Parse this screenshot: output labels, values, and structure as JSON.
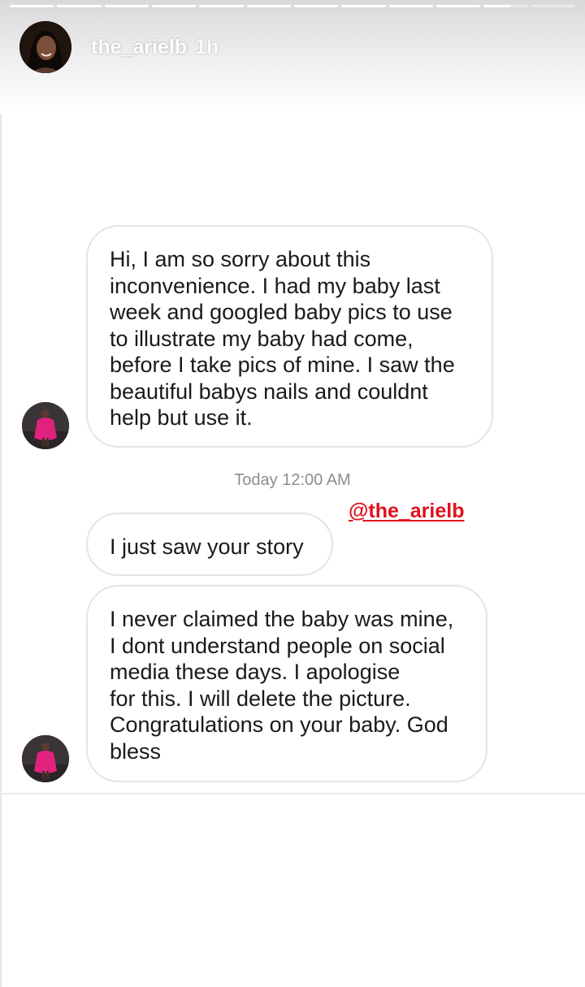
{
  "story_header": {
    "username": "the_arielb",
    "time_ago": "1h",
    "progress": {
      "segments_total": 12,
      "segments_viewed": 11,
      "current_segment_fraction": 0.6
    }
  },
  "messages": [
    {
      "id": "msg1",
      "text": "Hi, I am so sorry about this\ninconvenience. I had my baby last\nweek and googled baby pics to use\nto illustrate my baby had come,\nbefore I take pics of mine. I saw the\nbeautiful babys nails and couldnt\nhelp but use it."
    },
    {
      "id": "msg2",
      "text": "I just saw your story"
    },
    {
      "id": "msg3",
      "text": "I never claimed the baby was mine,\nI dont understand people on social\nmedia these days. I apologise\nfor this. I will delete the picture.\nCongratulations on your baby. God\nbless"
    }
  ],
  "timestamp": "Today 12:00 AM",
  "mention": "@the_arielb",
  "colors": {
    "mention": "#e0121e",
    "timestamp": "#8e8e8e",
    "bubble_border": "#e4e4e4"
  },
  "icons": [
    "profile-avatar",
    "sender-avatar"
  ]
}
